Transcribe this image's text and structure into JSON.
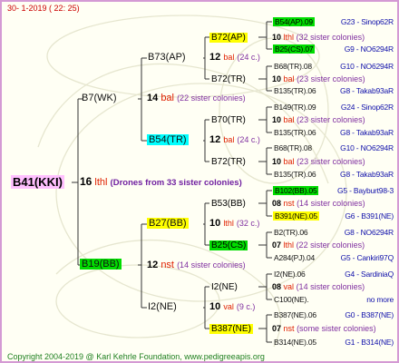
{
  "header": {
    "index": "30-",
    "datetime": "1-2019 ( 22: 25)"
  },
  "root": {
    "label": "B41(KKI)",
    "num": "16",
    "breed": "lthl",
    "note": "(Drones from 33 sister colonies)"
  },
  "gen1": {
    "father": {
      "label": "B7(WK)",
      "num": "14",
      "breed": "bal",
      "note": "(22 sister colonies)"
    },
    "mother": {
      "label": "B19(BB)",
      "num": "12",
      "breed": "nst",
      "note": "(14 sister colonies)"
    }
  },
  "gen2": {
    "ff": {
      "label": "B73(AP)",
      "num": "12",
      "breed": "bal",
      "note": "(24 c.)"
    },
    "fm": {
      "label": "B54(TR)",
      "num": "12",
      "breed": "bal",
      "note": "(24 c.)"
    },
    "mf": {
      "label": "B27(BB)",
      "num": "10",
      "breed": "lthl",
      "note": "(32 c.)"
    },
    "mm": {
      "label": "I2(NE)",
      "num": "10",
      "breed": "val",
      "note": "(9 c.)"
    }
  },
  "gen3": {
    "fff": {
      "label": "B72(AP)",
      "num": "10",
      "breed": "lthl",
      "note": "(32 sister colonies)"
    },
    "ffm": {
      "label": "B72(TR)",
      "num": "10",
      "breed": "bal",
      "note": "(23 sister colonies)"
    },
    "fmf": {
      "label": "B70(TR)",
      "num": "10",
      "breed": "bal",
      "note": "(23 sister colonies)"
    },
    "fmm": {
      "label": "B72(TR)",
      "num": "10",
      "breed": "bal",
      "note": "(23 sister colonies)"
    },
    "mff": {
      "label": "B53(BB)",
      "num": "08",
      "breed": "nst",
      "note": "(14 sister colonies)"
    },
    "mfm": {
      "label": "B25(CS)",
      "num": "07",
      "breed": "lthl",
      "note": "(22 sister colonies)"
    },
    "mmf": {
      "label": "I2(NE)",
      "num": "08",
      "breed": "val",
      "note": "(14 sister colonies)"
    },
    "mmm": {
      "label": "B387(NE)",
      "num": "07",
      "breed": "nst",
      "note": "(some sister colonies)"
    }
  },
  "gen4": [
    {
      "left": "B54(AP).09",
      "right": "G23 - Sinop62R"
    },
    {
      "left": "B25(CS).07",
      "right": "G9 - NO6294R"
    },
    {
      "left": "B68(TR).08",
      "right": "G10 - NO6294R"
    },
    {
      "left": "B135(TR).06",
      "right": "G8 - Takab93aR"
    },
    {
      "left": "B149(TR).09",
      "right": "G24 - Sinop62R"
    },
    {
      "left": "B135(TR).06",
      "right": "G8 - Takab93aR"
    },
    {
      "left": "B68(TR).08",
      "right": "G10 - NO6294R"
    },
    {
      "left": "B135(TR).06",
      "right": "G8 - Takab93aR"
    },
    {
      "left": "B102(BB).05",
      "right": "G5 - Bayburt98-3"
    },
    {
      "left": "B391(NE).05",
      "right": "G6 - B391(NE)"
    },
    {
      "left": "B2(TR).06",
      "right": "G8 - NO6294R"
    },
    {
      "left": "A284(PJ).04",
      "right": "G5 - Cankiri97Q"
    },
    {
      "left": "I2(NE).06",
      "right": "G4 - SardiniaQ"
    },
    {
      "left": "C100(NE).",
      "right": "no more"
    },
    {
      "left": "B387(NE).06",
      "right": "G0 - B387(NE)"
    },
    {
      "left": "B314(NE).05",
      "right": "G1 - B314(NE)"
    }
  ],
  "footer": {
    "copyright": "Copyright 2004-2019 @ Karl Kehrle Foundation",
    "site": "www.pedigreeapis.org"
  },
  "colors": {
    "frame_border": "#d49ad4",
    "background": "#fffff4",
    "highlight_yellow": "#ffff00",
    "highlight_green": "#00dd00",
    "highlight_cyan": "#00ffff",
    "highlight_pink": "#ffc0ff",
    "breed_red": "#e02000",
    "node_blue": "#1010aa"
  }
}
